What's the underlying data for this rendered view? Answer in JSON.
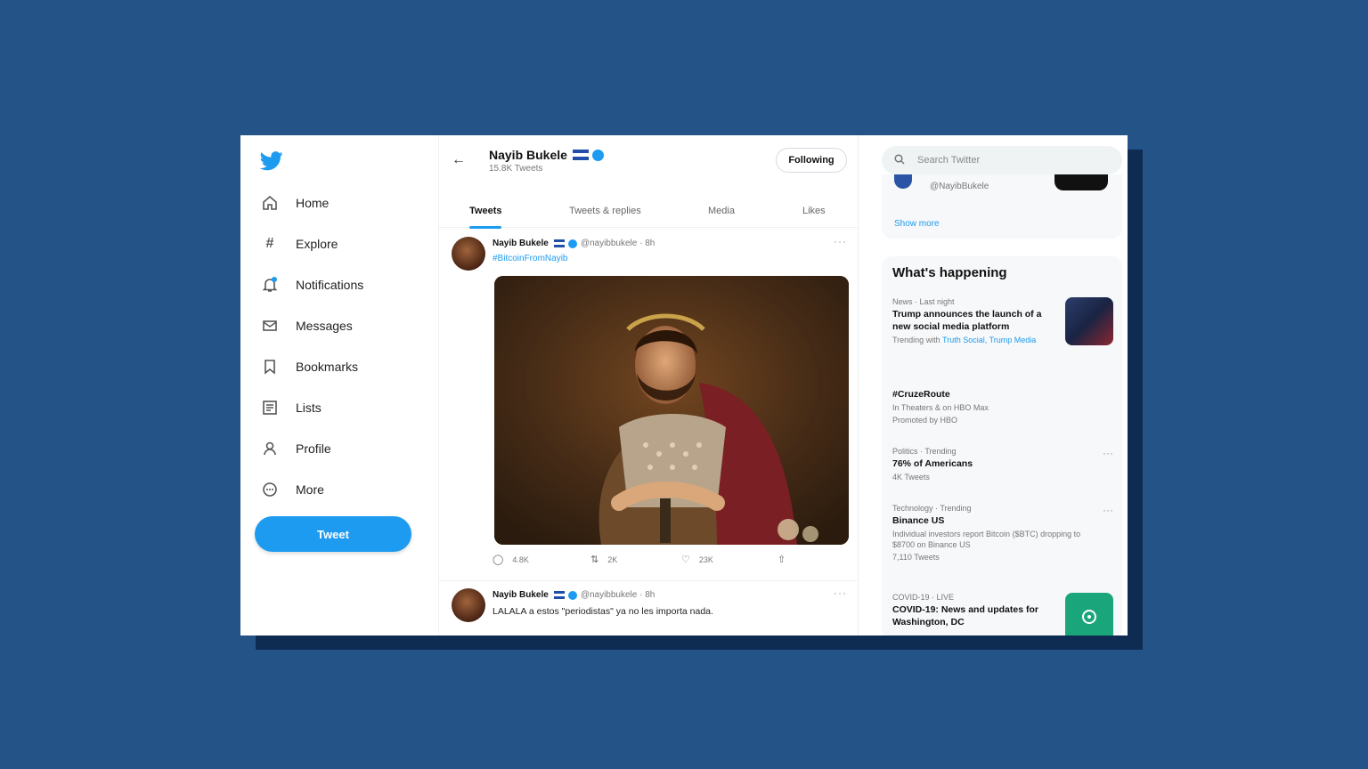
{
  "colors": {
    "background": "#245388",
    "accent": "#1d9bf0"
  },
  "nav": {
    "logo_icon": "bird-icon",
    "items": [
      {
        "label": "Home",
        "icon": "home-icon"
      },
      {
        "label": "Explore",
        "icon": "hashtag-icon"
      },
      {
        "label": "Notifications",
        "icon": "bell-icon"
      },
      {
        "label": "Messages",
        "icon": "envelope-icon"
      },
      {
        "label": "Bookmarks",
        "icon": "bookmark-icon"
      },
      {
        "label": "Lists",
        "icon": "list-icon"
      },
      {
        "label": "Profile",
        "icon": "person-icon"
      },
      {
        "label": "More",
        "icon": "more-circle-icon"
      }
    ],
    "tweet_button": "Tweet"
  },
  "profile": {
    "name": "Nayib Bukele",
    "tweet_count": "15.8K Tweets",
    "follow_button": "Following",
    "tabs": [
      "Tweets",
      "Tweets & replies",
      "Media",
      "Likes"
    ],
    "active_tab": "Tweets"
  },
  "tweets": [
    {
      "author": "Nayib Bukele",
      "meta": "@nayibbukele · 8h",
      "hashtag": "#BitcoinFromNayib",
      "stats": {
        "replies": "4.8K",
        "retweets": "2K",
        "likes": "23K"
      }
    },
    {
      "author": "Nayib Bukele",
      "meta": "@nayibbukele · 8h",
      "text": "LALALA a estos \"periodistas\" ya no les importa nada."
    }
  ],
  "right": {
    "search_placeholder": "Search Twitter",
    "card_handle": "@NayibBukele",
    "show_more": "Show more",
    "happening_title": "What's happening",
    "trends": [
      {
        "meta": "News · Last night",
        "title": "Trump announces the launch of a new social media platform",
        "sub_prefix": "Trending with",
        "sub_link": "Truth Social, Trump Media"
      },
      {
        "title": "#CruzeRoute",
        "sub": "In Theaters & on HBO Max",
        "sub2": "Promoted by HBO"
      },
      {
        "meta": "Politics · Trending",
        "title": "76% of Americans",
        "sub": "4K Tweets"
      },
      {
        "meta": "Technology · Trending",
        "title": "Binance US",
        "sub": "Individual investors report Bitcoin ($BTC) dropping to $8700 on Binance US",
        "sub2": "7,110 Tweets"
      },
      {
        "meta": "COVID-19 · LIVE",
        "title": "COVID-19: News and updates for Washington, DC"
      }
    ]
  }
}
